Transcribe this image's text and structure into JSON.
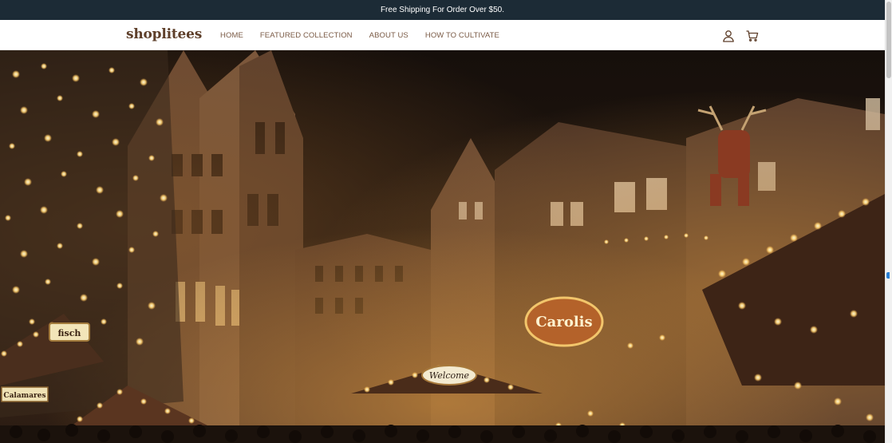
{
  "announcement": {
    "text": "Free Shipping For Order Over $50."
  },
  "header": {
    "logo": "shoplitees",
    "nav": [
      {
        "label": "HOME"
      },
      {
        "label": "FEATURED COLLECTION"
      },
      {
        "label": "ABOUT US"
      },
      {
        "label": "HOW TO CULTIVATE"
      }
    ],
    "icons": [
      "account-icon",
      "cart-icon"
    ]
  },
  "hero": {
    "signs": [
      "Welcome",
      "Carolis",
      "fisch",
      "Calamares"
    ]
  },
  "colors": {
    "announcement_bg": "#1c2b36",
    "logo": "#5e3f2a",
    "nav_text": "#7a5a45"
  }
}
